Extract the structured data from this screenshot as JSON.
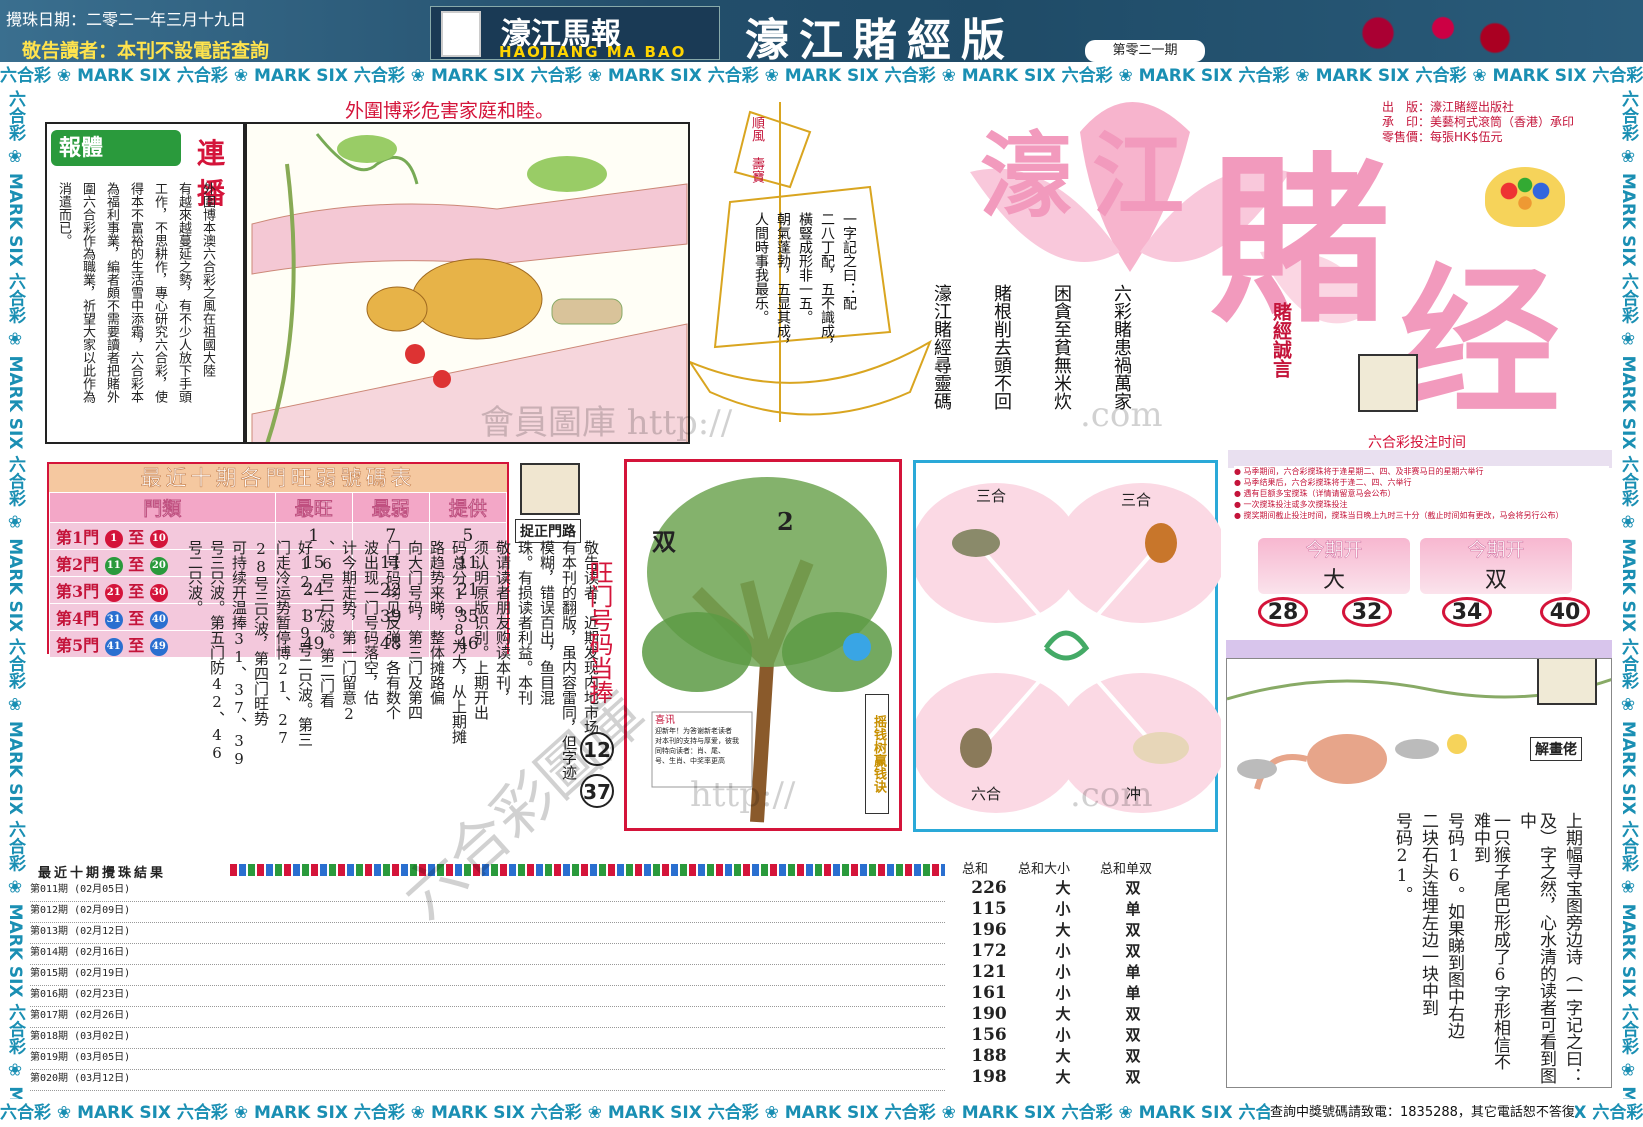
{
  "header": {
    "date_line": "攪珠日期：二零二一年三月十九日",
    "notice": "敬告讀者：本刊不設電話查詢",
    "logo_cn": "濠江馬報",
    "logo_en": "HAOJIANG MA BAO",
    "edition_title": "濠江賭經版",
    "issue_no": "第零二一期"
  },
  "border": {
    "strip_text": "六合彩 ❀ MARK SIX 六合彩 ❀ MARK SIX 六合彩 ❀ MARK SIX 六合彩 ❀ MARK SIX 六合彩 ❀ MARK SIX 六合彩 ❀ MARK SIX 六合彩 ❀ MARK SIX 六合彩 ❀ MARK SIX 六合彩 ❀ MARK SIX 六合彩 ❀ MARK SIX"
  },
  "comic": {
    "caption": "外圍博彩危害家庭和睦。",
    "badge": "報體",
    "badge_tail": "連播",
    "body_columns": [
      "外圍博本澳六合彩之風在祖國大陸",
      "有越來越蔓延之勢，有不少人放下手頭",
      "工作，不思耕作，專心研究六合彩，使",
      "得本不富裕的生活雪中添霜，六合彩本",
      "為福利事業，編者頗不需要讀者把賭外",
      "圍六合彩作為職業，祈望大家以此作為",
      "消遣而已。"
    ]
  },
  "boat": {
    "sail_text": "順風\n壽寶",
    "poem_columns": [
      "一字記之曰：配",
      "二八丁配，五不識成，",
      "橫豎成形非一五。",
      "朝氣蓬勃，五显其成，",
      "人間時事我最乐。"
    ]
  },
  "big_title": {
    "publisher_lines": [
      "出　版：濠江賭經出版社",
      "承　印：美藝柯式滾筒（香港）承印",
      "零售價：每張HK$伍元"
    ],
    "pink_1": "濠江",
    "pink_2": "賭",
    "pink_3": "经",
    "warning_title": "賭經誠言",
    "warning_columns": [
      "六彩賭患禍萬家",
      "困貪至貧無米炊",
      "賭根削去頭不回",
      "濠江賭經尋靈碼"
    ],
    "bet_time_label": "六合彩投注时间",
    "bet_info_lines": [
      "● 马季期间，六合彩搅珠将于逢星期二、四、及非赛马日的星期六举行",
      "● 马季结果后，六合彩搅珠将于逢二、四、六举行",
      "● 遇有巨额多宝搅珠（详情请留意马会公布）",
      "● 一次搅珠投注或多次搅珠投注",
      "● 搅奖期间截止投注时间，搅珠当日晚上九时三十分（截止时间如有更改，马会将另行公布）"
    ]
  },
  "strength_table": {
    "title": "最近十期各門旺弱號碼表",
    "columns": [
      "門類",
      "最旺",
      "最弱",
      "提供"
    ],
    "rows": [
      {
        "door": "第1門",
        "from": "1",
        "to": "10",
        "best": "1",
        "worst": "7",
        "offer": "5"
      },
      {
        "door": "第2門",
        "from": "11",
        "to": "20",
        "best": "15",
        "worst": "11",
        "offer": "11"
      },
      {
        "door": "第3門",
        "from": "21",
        "to": "30",
        "best": "24",
        "worst": "22",
        "offer": "21"
      },
      {
        "door": "第4門",
        "from": "31",
        "to": "40",
        "best": "37",
        "worst": "39",
        "offer": "35"
      },
      {
        "door": "第5門",
        "from": "41",
        "to": "49",
        "best": "49",
        "worst": "48",
        "offer": "46"
      }
    ],
    "ball_colors": [
      "#d4143a",
      "#2a9a3c",
      "#d4143a",
      "#2a6fd0",
      "#2a6fd0"
    ],
    "to_word": "至"
  },
  "catch_door": {
    "label": "捉正門路",
    "analysis_columns": [
      "敬告读者：近期发现内地市场上",
      "有本刊的翻版，虽内容雷同，但字迹",
      "模糊，错误百出，鱼目混",
      "珠。有损读者利益。本刊",
      "敬请读者朋友购读本刊，",
      "须认明原版识别。上期开出",
      "码总分198为大，从上期摊",
      "路趋势来睇，整体摊路偏",
      "向大门号码，第三门及第四",
      "门号码均见反弹，各有数个",
      "波出现一门号码落空，估",
      "计今期走势，第一门留意2",
      "、6号二只波。第二门看",
      "好12、19号二只波。第三",
      "门走冷运势暂停博21、27",
      "28号三只波，第四门旺势",
      "可持续开温捧31、37、39",
      "号三只波。第五门防42、46",
      "号二只波。"
    ],
    "hot_label": "旺门号码当捧",
    "hot_numbers": [
      "12",
      "37"
    ]
  },
  "tree": {
    "label_left": "双",
    "label_right": "2",
    "tag": "摇钱树赢钱诀",
    "mini_title": "喜讯",
    "mini_lines": [
      "迎新年！为答谢新老读者",
      "对本刊的支持与厚爱，彼我",
      "同特向读者：肖、尾、",
      "号、生肖、中奖率更高"
    ]
  },
  "zodiac": {
    "top_left": "三合",
    "top_right": "三合",
    "bottom_left": "六合",
    "bottom_right": "冲"
  },
  "this_period": {
    "head": "今期开",
    "value_1": "大",
    "value_2": "双",
    "numbers": [
      "28",
      "32",
      "34",
      "40"
    ]
  },
  "monkey": {
    "label": "解畫佬",
    "text_columns": [
      "上期幅寻宝图旁边诗（一字记之曰：",
      "及）字之然，心水清的读者可看到图中",
      "一只猴子尾巴形成了6字形相信不难中到",
      "号码16。如果睇到图中右边",
      "二块石头连埋左边一块中到",
      "号码21。"
    ]
  },
  "results": {
    "title": "最近十期攪珠結果",
    "rows": [
      {
        "period": "第011期 (02月05日)",
        "sum": "226",
        "size": "大",
        "parity": "双"
      },
      {
        "period": "第012期 (02月09日)",
        "sum": "115",
        "size": "小",
        "parity": "单"
      },
      {
        "period": "第013期 (02月12日)",
        "sum": "196",
        "size": "大",
        "parity": "双"
      },
      {
        "period": "第014期 (02月16日)",
        "sum": "172",
        "size": "小",
        "parity": "双"
      },
      {
        "period": "第015期 (02月19日)",
        "sum": "121",
        "size": "小",
        "parity": "单"
      },
      {
        "period": "第016期 (02月23日)",
        "sum": "161",
        "size": "小",
        "parity": "单"
      },
      {
        "period": "第017期 (02月26日)",
        "sum": "190",
        "size": "大",
        "parity": "双"
      },
      {
        "period": "第018期 (03月02日)",
        "sum": "156",
        "size": "小",
        "parity": "双"
      },
      {
        "period": "第019期 (03月05日)",
        "sum": "188",
        "size": "大",
        "parity": "双"
      },
      {
        "period": "第020期 (03月12日)",
        "sum": "198",
        "size": "大",
        "parity": "双"
      }
    ],
    "sum_header": "总和",
    "size_header": "总和大小",
    "parity_header": "总和单双"
  },
  "footer": {
    "query_line": "查詢中獎號碼請致電：1835288，其它電話恕不答復"
  },
  "watermarks": {
    "wm1": "會員圖庫 http://",
    "wm2": ".com",
    "wm3": "六合彩圖庫",
    "wm4": "http://",
    "wm5": ".com"
  }
}
